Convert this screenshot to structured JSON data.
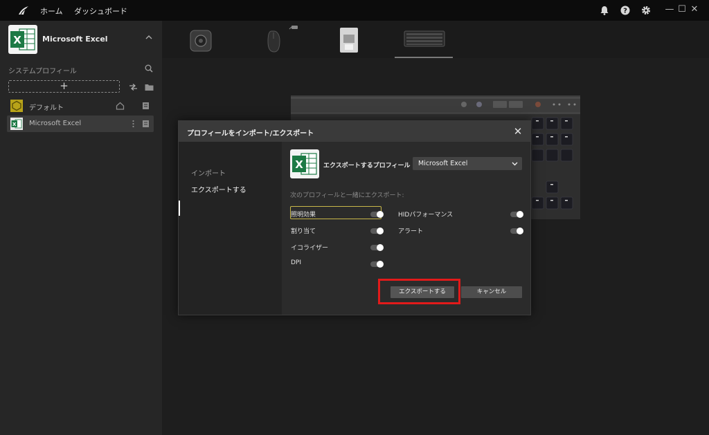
{
  "titlebar": {
    "nav": [
      "ホーム",
      "ダッシュボード"
    ],
    "icons": [
      "bell-icon",
      "help-icon",
      "gear-icon"
    ],
    "window_controls": [
      "—",
      "☐",
      "✕"
    ]
  },
  "sidebar": {
    "profile_title": "Microsoft Excel",
    "section_label": "システムプロフィール",
    "add_label": "+",
    "profiles": [
      {
        "label": "デフォルト"
      },
      {
        "label": "Microsoft Excel"
      }
    ]
  },
  "dialog": {
    "title": "プロフィールをインポート/エクスポート",
    "close": "✕",
    "tabs": [
      "インポート",
      "エクスポートする"
    ],
    "active_tab": "エクスポートする",
    "export_profile_label": "エクスポートするプロフィール",
    "selected_profile": "Microsoft Excel",
    "hint": "次のプロフィールと一緒にエクスポート:",
    "options": [
      {
        "label": "照明効果",
        "on": true
      },
      {
        "label": "割り当て",
        "on": true
      },
      {
        "label": "イコライザー",
        "on": true
      },
      {
        "label": "DPI",
        "on": true
      },
      {
        "label": "HIDパフォーマンス",
        "on": true
      },
      {
        "label": "アラート",
        "on": true
      }
    ],
    "export_button": "エクスポートする",
    "cancel_button": "キャンセル"
  },
  "colors": {
    "highlight_frame": "#e21a1a",
    "focus_border": "#c9b84a",
    "excel_green": "#1d7a45"
  }
}
